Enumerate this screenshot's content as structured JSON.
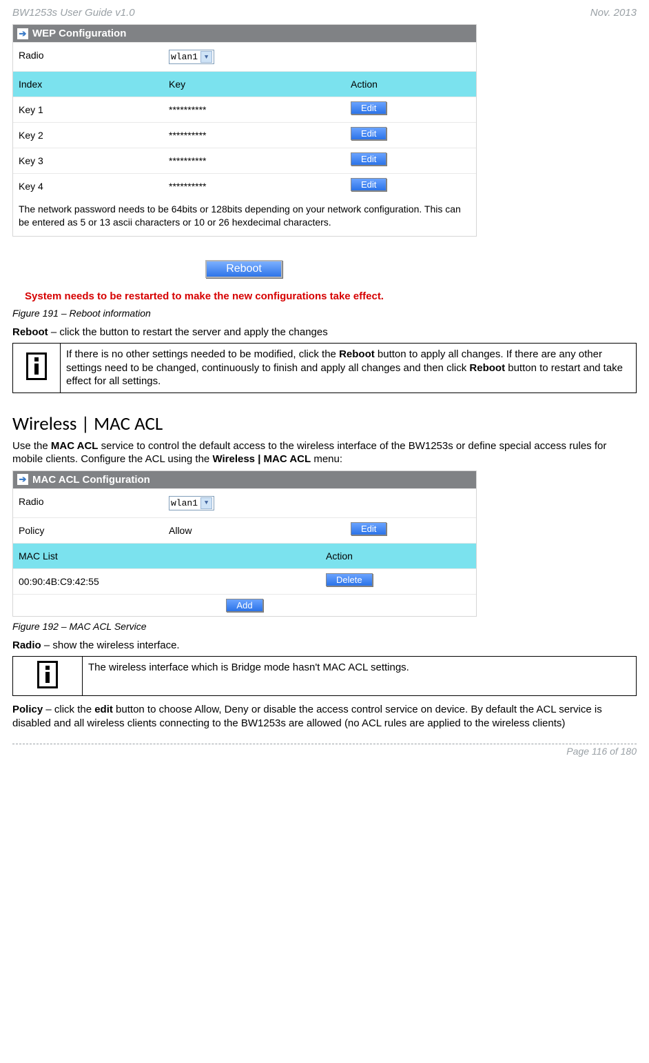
{
  "header": {
    "left": "BW1253s User Guide v1.0",
    "right": "Nov.  2013"
  },
  "wep": {
    "title": "WEP Configuration",
    "radio_label": "Radio",
    "radio_value": "wlan1",
    "cols": {
      "index": "Index",
      "key": "Key",
      "action": "Action"
    },
    "rows": [
      {
        "index": "Key 1",
        "key": "**********",
        "action": "Edit"
      },
      {
        "index": "Key 2",
        "key": "**********",
        "action": "Edit"
      },
      {
        "index": "Key 3",
        "key": "**********",
        "action": "Edit"
      },
      {
        "index": "Key 4",
        "key": "**********",
        "action": "Edit"
      }
    ],
    "note": "The network password needs to be 64bits or 128bits depending on your network configuration. This can be entered as 5 or 13 ascii characters or 10 or 26 hexdecimal characters."
  },
  "reboot": {
    "button": "Reboot",
    "red": "System needs to be restarted to make the new configurations take effect.",
    "caption": "Figure 191 – Reboot information",
    "line_prefix": "Reboot",
    "line_rest": " – click the button to restart the server and apply the changes",
    "info_pre": "If there is no other settings needed to be modified, click the ",
    "info_b1": "Reboot",
    "info_mid": " button to apply all changes. If there are any other settings need to be changed, continuously to finish and apply all changes and then click ",
    "info_b2": "Reboot",
    "info_post": " button to restart and take effect  for all settings."
  },
  "macacl": {
    "heading": "Wireless | MAC ACL",
    "intro_pre": "Use the ",
    "intro_b1": "MAC ACL",
    "intro_mid": " service to control the default access to the wireless interface of the BW1253s or define special access rules for mobile clients. Configure the ACL using the ",
    "intro_b2": "Wireless | MAC ACL",
    "intro_post": " menu:",
    "panel_title": "MAC ACL Configuration",
    "radio_label": "Radio",
    "radio_value": "wlan1",
    "policy_label": "Policy",
    "policy_value": "Allow",
    "policy_action": "Edit",
    "list_header": "MAC List",
    "action_header": "Action",
    "mac_value": "00:90:4B:C9:42:55",
    "delete": "Delete",
    "add": "Add",
    "caption": "Figure 192 – MAC ACL Service",
    "radio_line_b": "Radio",
    "radio_line_rest": " – show the wireless interface.",
    "info_note": "The wireless interface which is Bridge mode hasn't MAC ACL settings.",
    "policy_b": "Policy",
    "policy_mid1": " – click the ",
    "policy_edit": "edit",
    "policy_rest": " button to choose Allow, Deny or disable the access control service on device. By default the ACL service is disabled and all wireless clients connecting to the BW1253s are allowed (no ACL rules are applied to the wireless clients)"
  },
  "footer": {
    "page": "Page 116 of 180"
  },
  "chart_data": {
    "type": "table",
    "title": "WEP Configuration",
    "columns": [
      "Index",
      "Key",
      "Action"
    ],
    "rows": [
      [
        "Key 1",
        "**********",
        "Edit"
      ],
      [
        "Key 2",
        "**********",
        "Edit"
      ],
      [
        "Key 3",
        "**********",
        "Edit"
      ],
      [
        "Key 4",
        "**********",
        "Edit"
      ]
    ]
  }
}
